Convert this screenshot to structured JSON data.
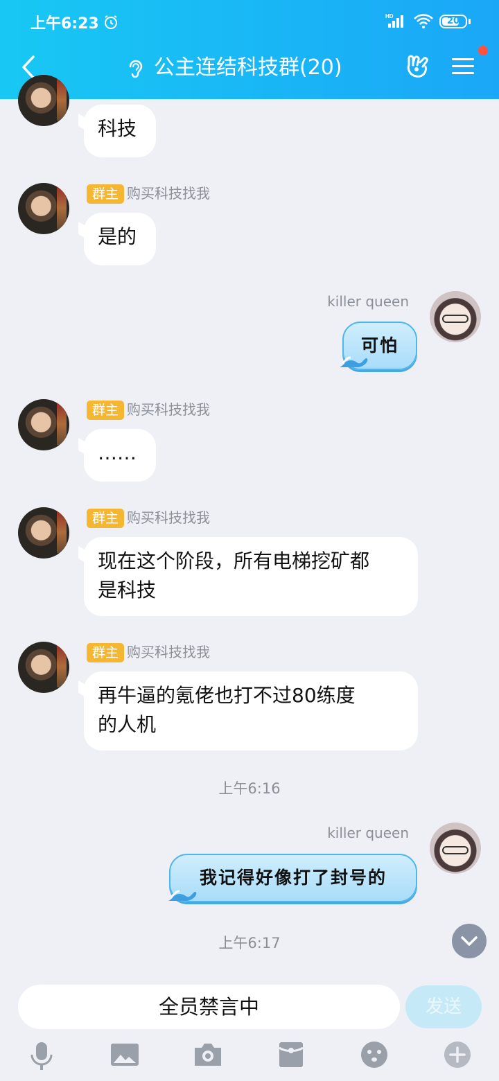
{
  "status_bar": {
    "time": "上午6:23",
    "battery": "20"
  },
  "header": {
    "title": "公主连结科技群(20)"
  },
  "messages": [
    {
      "side": "left",
      "text": "科技"
    },
    {
      "side": "left",
      "badge": "群主",
      "sender": "购买科技找我",
      "text": "是的"
    },
    {
      "side": "right",
      "sender": "killer queen",
      "text": "可怕"
    },
    {
      "side": "left",
      "badge": "群主",
      "sender": "购买科技找我",
      "text": "……"
    },
    {
      "side": "left",
      "badge": "群主",
      "sender": "购买科技找我",
      "lines": [
        "现在这个阶段，所有电梯挖矿都",
        "是科技"
      ]
    },
    {
      "side": "left",
      "badge": "群主",
      "sender": "购买科技找我",
      "lines": [
        "再牛逼的氪佬也打不过80练度",
        "的人机"
      ]
    },
    {
      "side": "right",
      "sender": "killer queen",
      "text": "我记得好像打了封号的"
    }
  ],
  "time_dividers": [
    "上午6:16",
    "上午6:17"
  ],
  "input": {
    "placeholder": "全员禁言中",
    "send_label": "发送"
  },
  "toolbar": [
    "microphone-icon",
    "image-icon",
    "camera-icon",
    "red-packet-icon",
    "emoji-icon",
    "plus-icon"
  ],
  "colors": {
    "header_from": "#18c8f4",
    "header_to": "#1aa7f7",
    "badge": "#f5b731",
    "background": "#eef0f5"
  }
}
